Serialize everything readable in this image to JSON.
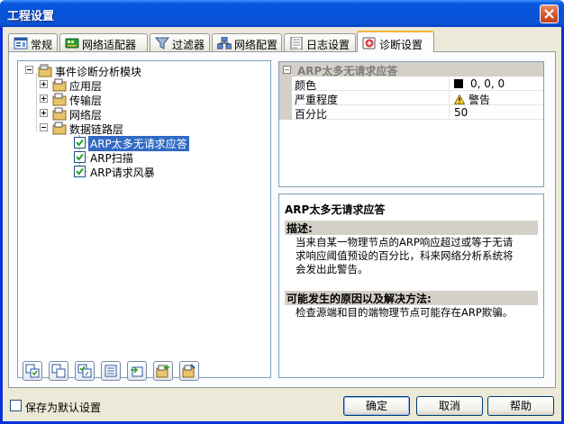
{
  "window": {
    "title": "工程设置"
  },
  "tabs": [
    {
      "label": "常规",
      "icon": "general-icon"
    },
    {
      "label": "网络适配器",
      "icon": "network-adapter-icon"
    },
    {
      "label": "过滤器",
      "icon": "filter-icon"
    },
    {
      "label": "网络配置",
      "icon": "network-config-icon"
    },
    {
      "label": "日志设置",
      "icon": "log-settings-icon"
    },
    {
      "label": "诊断设置",
      "icon": "diagnosis-icon",
      "active": true
    }
  ],
  "tree": {
    "root": "事件诊断分析模块",
    "layers": [
      "应用层",
      "传输层",
      "网络层",
      "数据链路层"
    ],
    "items": [
      "ARP太多无请求应答",
      "ARP扫描",
      "ARP请求风暴"
    ],
    "selected_item": "ARP太多无请求应答"
  },
  "property_grid": {
    "header": "ARP太多无请求应答",
    "rows": [
      {
        "name": "颜色",
        "value": "0, 0, 0",
        "swatch": "#000000"
      },
      {
        "name": "严重程度",
        "value": "警告",
        "icon": "warning-icon"
      },
      {
        "name": "百分比",
        "value": "50"
      }
    ]
  },
  "description": {
    "title": "ARP太多无请求应答",
    "desc_label": "描述:",
    "desc_lines": [
      "当来自某一物理节点的ARP响应超过或等于无请",
      "求响应阈值预设的百分比，科来网络分析系统将",
      "会发出此警告。"
    ],
    "cause_label": "可能发生的原因以及解决方法:",
    "cause_text": "检查源端和目的端物理节点可能存在ARP欺骗。"
  },
  "bottom": {
    "save_default_label": "保存为默认设置",
    "ok_label": "确定",
    "cancel_label": "取消",
    "help_label": "帮助"
  },
  "colors": {
    "titlebar": "#0a5be0",
    "dialog_bg": "#ece9d8",
    "selection": "#316ac5",
    "active_tab_accent": "#f4b43a"
  }
}
